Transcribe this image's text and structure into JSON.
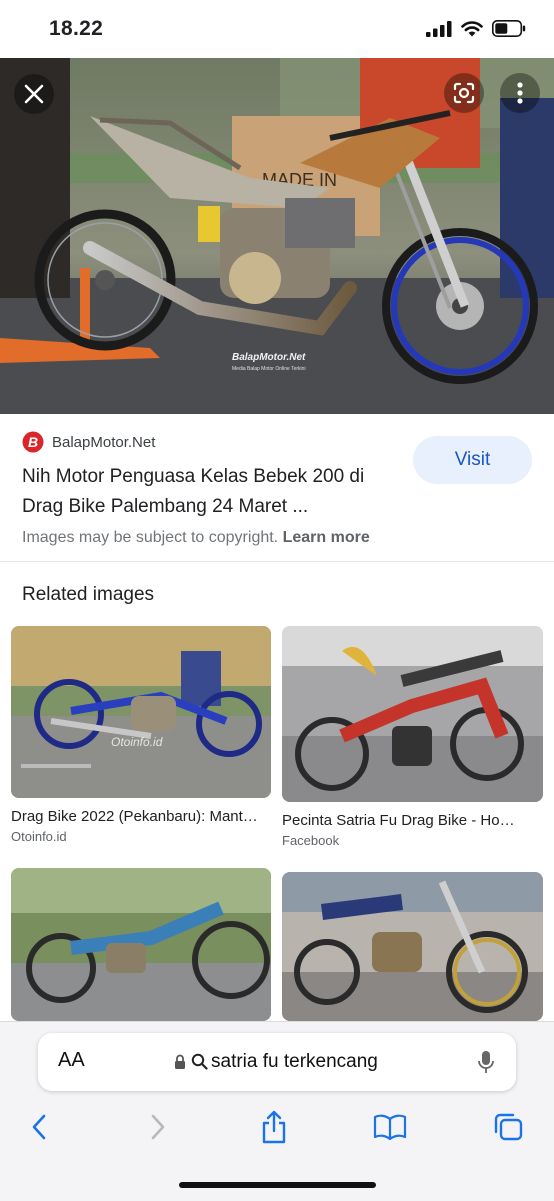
{
  "status": {
    "time": "18.22"
  },
  "hero": {
    "watermark": "BalapMotor.Net",
    "watermark_sub": "Media Balap Motor Online Terkini",
    "box_text": "MADE IN"
  },
  "result": {
    "source": "BalapMotor.Net",
    "title": "Nih Motor Penguasa Kelas Bebek 200 di Drag Bike Palembang 24 Maret ...",
    "visit_label": "Visit",
    "copyright": "Images may be subject to copyright.",
    "learn_more": "Learn more"
  },
  "related": {
    "heading": "Related images",
    "items": [
      {
        "title": "Drag Bike 2022 (Pekanbaru): Mant…",
        "source": "Otoinfo.id",
        "watermark": "Otoinfo.id"
      },
      {
        "title": "Pecinta Satria Fu Drag Bike - Ho…",
        "source": "Facebook"
      },
      {
        "title": "",
        "source": ""
      },
      {
        "title": "",
        "source": ""
      }
    ]
  },
  "browser": {
    "aa_label": "AA",
    "url": "satria fu terkencang"
  },
  "colors": {
    "accent": "#1a73e8",
    "visit_bg": "#e8f0fe",
    "toolbar_icon": "#1a73e8"
  }
}
